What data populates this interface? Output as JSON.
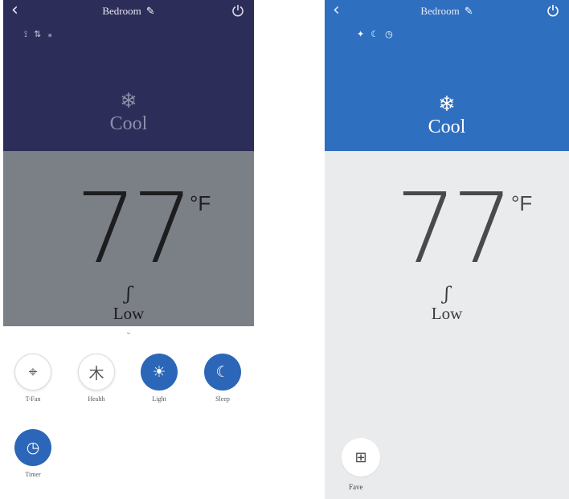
{
  "left_screen": {
    "title": "Bedroom",
    "status_icons": [
      "⟟",
      "⇅",
      "⁎"
    ],
    "mode": {
      "icon": "❄",
      "label": "Cool"
    },
    "temperature": {
      "value": "77",
      "unit": "°F"
    },
    "fan": {
      "icon": "ʃ",
      "label": "Low"
    },
    "functions": [
      {
        "label": "T-Fan",
        "icon": "⌖",
        "active": false
      },
      {
        "label": "Health",
        "icon": "⽊",
        "active": false
      },
      {
        "label": "Light",
        "icon": "☀",
        "active": true
      },
      {
        "label": "Sleep",
        "icon": "☾",
        "active": true
      },
      {
        "label": "Timer",
        "icon": "◷",
        "active": true
      }
    ]
  },
  "right_screen": {
    "title": "Bedroom",
    "status_icons": [
      "✦",
      "☾",
      "◷"
    ],
    "mode": {
      "icon": "❄",
      "label": "Cool"
    },
    "temperature": {
      "value": "77",
      "unit": "°F"
    },
    "fan": {
      "icon": "ʃ",
      "label": "Low"
    },
    "fave": {
      "label": "Fave",
      "icon": "⊞"
    }
  },
  "colors": {
    "left_header": "#2c2d58",
    "left_body": "#7b7f86",
    "right_header": "#2f6fc0",
    "right_body": "#e9ebec",
    "accent_blue": "#2b66b8"
  }
}
